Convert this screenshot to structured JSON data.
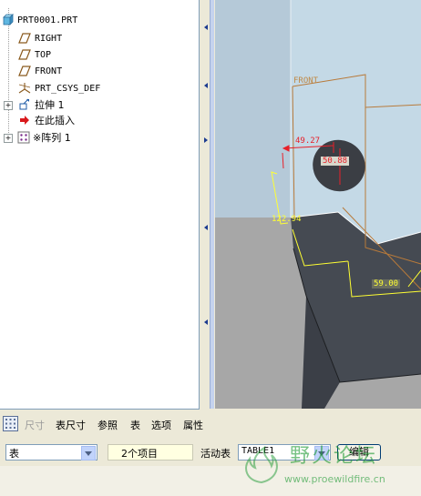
{
  "model_tree": {
    "root": "PRT0001.PRT",
    "items": [
      {
        "label": "RIGHT",
        "icon": "datum-plane-icon"
      },
      {
        "label": "TOP",
        "icon": "datum-plane-icon"
      },
      {
        "label": "FRONT",
        "icon": "datum-plane-icon"
      },
      {
        "label": "PRT_CSYS_DEF",
        "icon": "coordinate-system-icon"
      },
      {
        "label": "拉伸 1",
        "icon": "extrude-icon"
      },
      {
        "label": "在此插入",
        "icon": "insert-here-arrow-icon"
      },
      {
        "label": "※阵列 1",
        "icon": "pattern-icon"
      }
    ]
  },
  "viewport": {
    "datum_label": "FRONT",
    "dims": {
      "d1": "49.27",
      "d2": "50.88",
      "d3": "122.94",
      "d4": "59.00"
    },
    "colors": {
      "background": "#a7a7a7",
      "model_top_face": "#c4d9e6",
      "model_front_face": "#454a52",
      "datum_line": "#b87a3a",
      "dimension_red": "#e8202a",
      "dimension_yellow": "#ffff33"
    }
  },
  "dashboard": {
    "tabs": [
      "尺寸",
      "表尺寸",
      "参照",
      "表",
      "选项",
      "属性"
    ],
    "table_icon": "table-grid-icon",
    "type_select": "表",
    "items_count": "2个项目",
    "active_table_label": "活动表",
    "active_table_value": "TABLE1",
    "edit_button": "编辑"
  },
  "watermark": {
    "title": "野火论坛",
    "url": "www.proewildfire.cn"
  }
}
